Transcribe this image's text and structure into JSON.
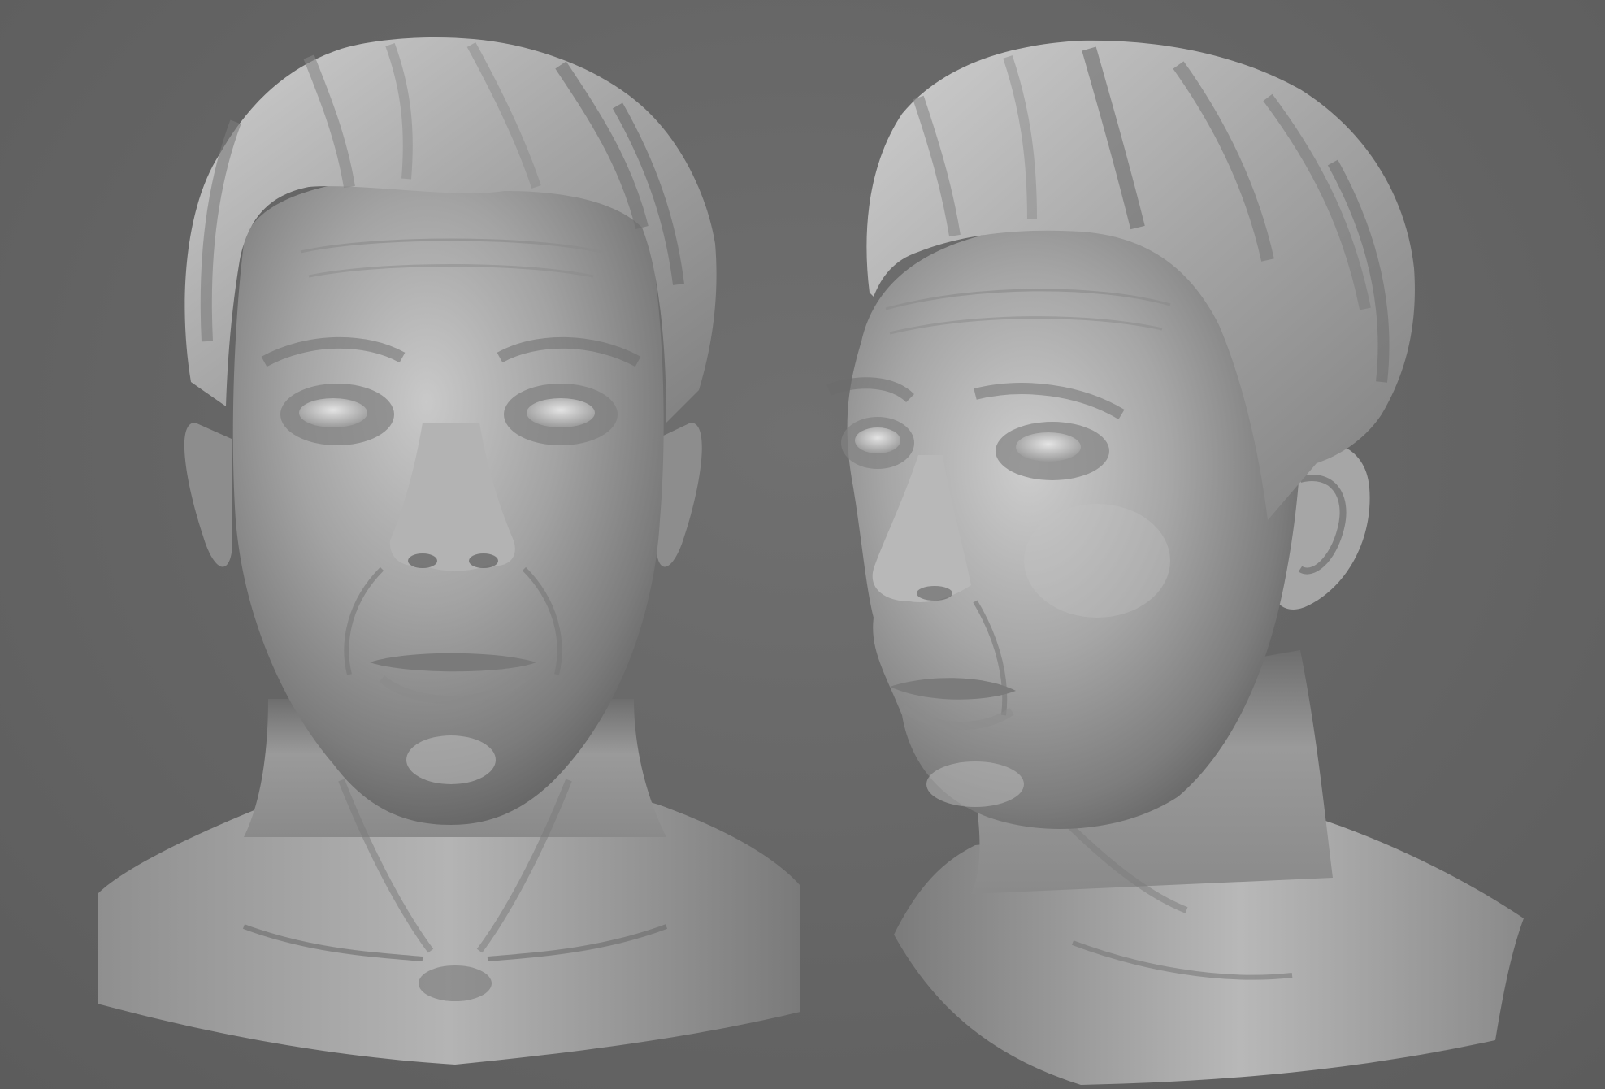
{
  "scene": {
    "background_color": "#666666",
    "clay_color": "#9a9a9a",
    "views": [
      {
        "name": "front-view",
        "description_icon": "head-bust-front"
      },
      {
        "name": "three-quarter-view",
        "description_icon": "head-bust-three-quarter"
      }
    ]
  }
}
